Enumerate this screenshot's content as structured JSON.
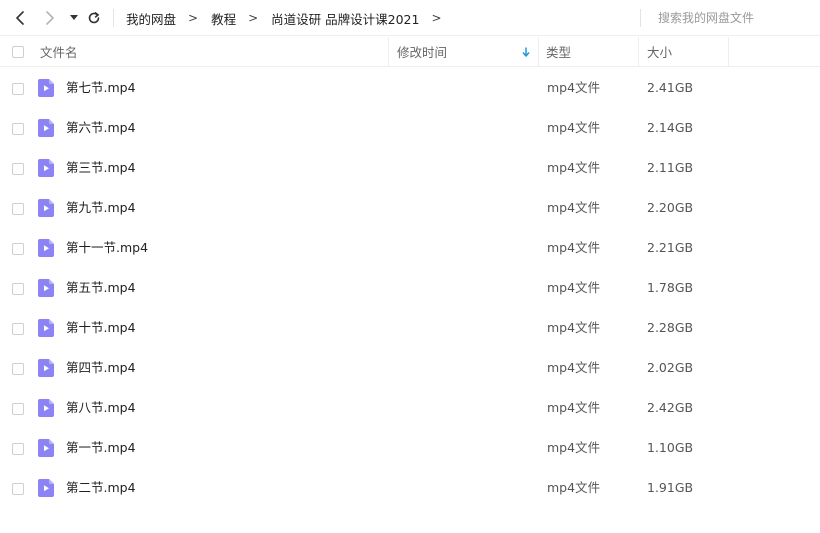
{
  "toolbar": {
    "back_icon": "chevron-left-icon",
    "forward_icon": "chevron-right-icon",
    "history_icon": "caret-down-icon",
    "refresh_icon": "refresh-icon"
  },
  "breadcrumb": {
    "items": [
      "我的网盘",
      "教程",
      "尚道设研 品牌设计课2021"
    ],
    "separator": ">"
  },
  "search": {
    "placeholder": "搜索我的网盘文件"
  },
  "columns": {
    "name": "文件名",
    "modified": "修改时间",
    "type": "类型",
    "size": "大小",
    "sort_icon": "arrow-down-icon",
    "sort_color": "#1e9ad6"
  },
  "file_icon_color": "#8c83f5",
  "files": [
    {
      "name": "第七节.mp4",
      "modified": "",
      "type": "mp4文件",
      "size": "2.41GB"
    },
    {
      "name": "第六节.mp4",
      "modified": "",
      "type": "mp4文件",
      "size": "2.14GB"
    },
    {
      "name": "第三节.mp4",
      "modified": "",
      "type": "mp4文件",
      "size": "2.11GB"
    },
    {
      "name": "第九节.mp4",
      "modified": "",
      "type": "mp4文件",
      "size": "2.20GB"
    },
    {
      "name": "第十一节.mp4",
      "modified": "",
      "type": "mp4文件",
      "size": "2.21GB"
    },
    {
      "name": "第五节.mp4",
      "modified": "",
      "type": "mp4文件",
      "size": "1.78GB"
    },
    {
      "name": "第十节.mp4",
      "modified": "",
      "type": "mp4文件",
      "size": "2.28GB"
    },
    {
      "name": "第四节.mp4",
      "modified": "",
      "type": "mp4文件",
      "size": "2.02GB"
    },
    {
      "name": "第八节.mp4",
      "modified": "",
      "type": "mp4文件",
      "size": "2.42GB"
    },
    {
      "name": "第一节.mp4",
      "modified": "",
      "type": "mp4文件",
      "size": "1.10GB"
    },
    {
      "name": "第二节.mp4",
      "modified": "",
      "type": "mp4文件",
      "size": "1.91GB"
    }
  ]
}
